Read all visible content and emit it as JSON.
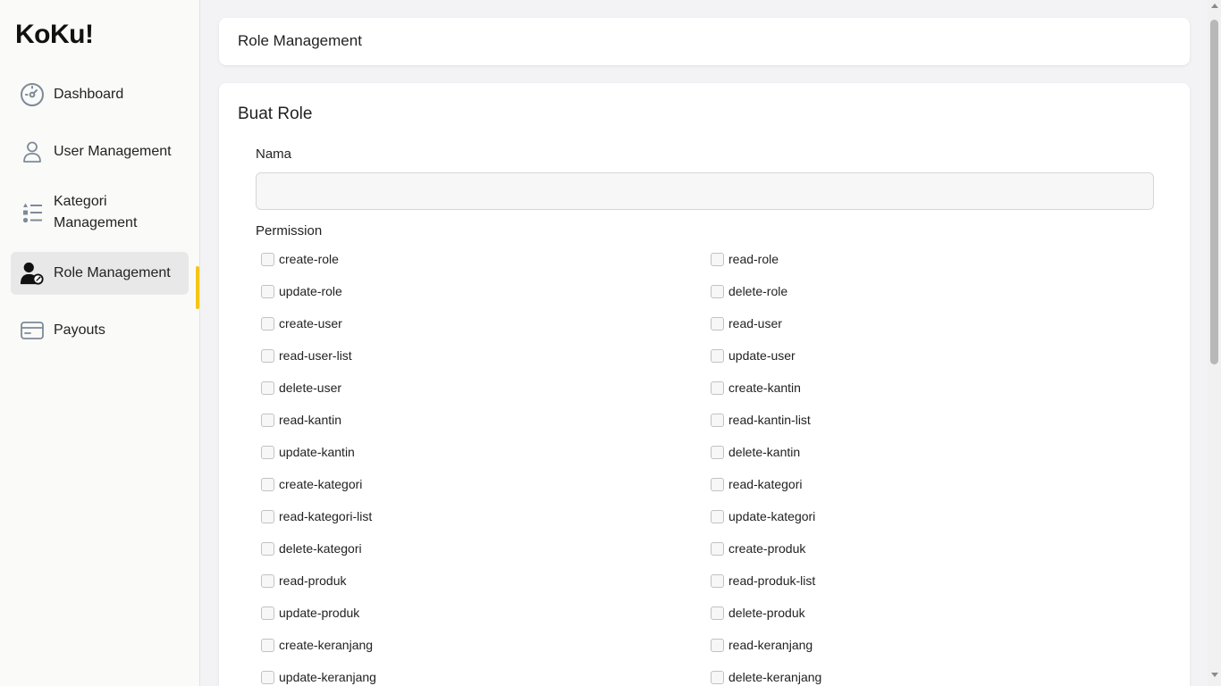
{
  "app": {
    "logo": "KoKu!"
  },
  "sidebar": {
    "items": [
      {
        "label": "Dashboard",
        "icon": "gauge-icon"
      },
      {
        "label": "User Management",
        "icon": "user-icon"
      },
      {
        "label": "Kategori Management",
        "icon": "list-icon"
      },
      {
        "label": "Role Management",
        "icon": "user-key-icon",
        "active": true
      },
      {
        "label": "Payouts",
        "icon": "credit-card-icon"
      }
    ],
    "accent_color": "#f5c518"
  },
  "header": {
    "title": "Role Management"
  },
  "form": {
    "title": "Buat Role",
    "name_label": "Nama",
    "name_value": "",
    "name_placeholder": "",
    "permission_label": "Permission",
    "permissions": [
      "create-role",
      "read-role",
      "update-role",
      "delete-role",
      "create-user",
      "read-user",
      "read-user-list",
      "update-user",
      "delete-user",
      "create-kantin",
      "read-kantin",
      "read-kantin-list",
      "update-kantin",
      "delete-kantin",
      "create-kategori",
      "read-kategori",
      "read-kategori-list",
      "update-kategori",
      "delete-kategori",
      "create-produk",
      "read-produk",
      "read-produk-list",
      "update-produk",
      "delete-produk",
      "create-keranjang",
      "read-keranjang",
      "update-keranjang",
      "delete-keranjang"
    ]
  }
}
